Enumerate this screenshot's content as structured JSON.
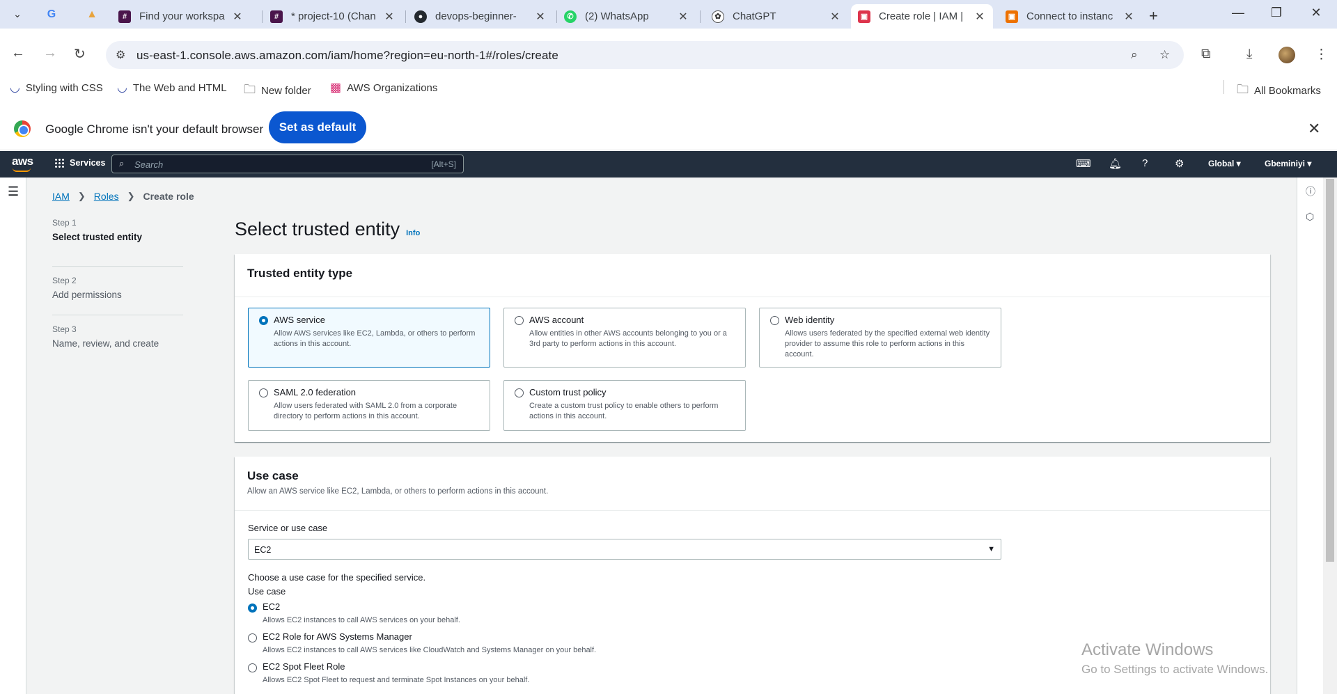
{
  "browser": {
    "tabs": [
      {
        "label": "Find your workspa",
        "icon": "slack-icon"
      },
      {
        "label": "* project-10 (Chan",
        "icon": "slack-icon"
      },
      {
        "label": "devops-beginner-",
        "icon": "github-icon"
      },
      {
        "label": "(2) WhatsApp",
        "icon": "whatsapp-icon"
      },
      {
        "label": "ChatGPT",
        "icon": "chatgpt-icon"
      },
      {
        "label": "Create role | IAM |",
        "icon": "aws-iam-icon",
        "active": true
      },
      {
        "label": "Connect to instanc",
        "icon": "aws-ec2-icon"
      }
    ],
    "url": "us-east-1.console.aws.amazon.com/iam/home?region=eu-north-1#/roles/create",
    "bookmarks": [
      "Styling with CSS",
      "The Web and HTML",
      "New folder",
      "AWS Organizations"
    ],
    "all_bookmarks": "All Bookmarks",
    "infobar": {
      "text": "Google Chrome isn't your default browser",
      "button": "Set as default"
    }
  },
  "aws_header": {
    "logo": "aws",
    "services": "Services",
    "search_placeholder": "Search",
    "search_shortcut": "[Alt+S]",
    "region": "Global",
    "user": "Gbeminiyi"
  },
  "breadcrumb": {
    "items": [
      "IAM",
      "Roles"
    ],
    "current": "Create role"
  },
  "steps": [
    {
      "number": "Step 1",
      "name": "Select trusted entity",
      "active": true
    },
    {
      "number": "Step 2",
      "name": "Add permissions"
    },
    {
      "number": "Step 3",
      "name": "Name, review, and create"
    }
  ],
  "page_title": "Select trusted entity",
  "info_link": "Info",
  "trusted_entity": {
    "title": "Trusted entity type",
    "options": [
      {
        "title": "AWS service",
        "desc": "Allow AWS services like EC2, Lambda, or others to perform actions in this account.",
        "selected": true
      },
      {
        "title": "AWS account",
        "desc": "Allow entities in other AWS accounts belonging to you or a 3rd party to perform actions in this account."
      },
      {
        "title": "Web identity",
        "desc": "Allows users federated by the specified external web identity provider to assume this role to perform actions in this account."
      },
      {
        "title": "SAML 2.0 federation",
        "desc": "Allow users federated with SAML 2.0 from a corporate directory to perform actions in this account."
      },
      {
        "title": "Custom trust policy",
        "desc": "Create a custom trust policy to enable others to perform actions in this account."
      }
    ]
  },
  "use_case": {
    "title": "Use case",
    "desc": "Allow an AWS service like EC2, Lambda, or others to perform actions in this account.",
    "service_label": "Service or use case",
    "service_value": "EC2",
    "choose_label": "Choose a use case for the specified service.",
    "use_case_label": "Use case",
    "options": [
      {
        "title": "EC2",
        "desc": "Allows EC2 instances to call AWS services on your behalf.",
        "selected": true
      },
      {
        "title": "EC2 Role for AWS Systems Manager",
        "desc": "Allows EC2 instances to call AWS services like CloudWatch and Systems Manager on your behalf."
      },
      {
        "title": "EC2 Spot Fleet Role",
        "desc": "Allows EC2 Spot Fleet to request and terminate Spot Instances on your behalf."
      }
    ]
  },
  "watermark": {
    "line1": "Activate Windows",
    "line2": "Go to Settings to activate Windows."
  }
}
